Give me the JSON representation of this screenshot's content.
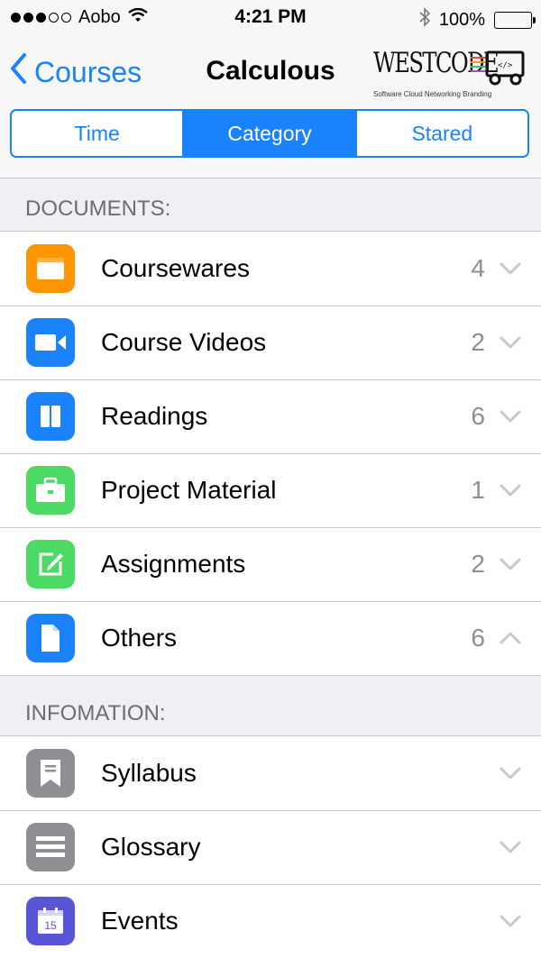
{
  "status_bar": {
    "carrier": "Aobo",
    "time": "4:21 PM",
    "battery": "100%"
  },
  "nav": {
    "back_label": "Courses",
    "title": "Calculous",
    "logo": {
      "word": "WESTCODE",
      "tagline": "Software  Cloud  Networking  Branding"
    }
  },
  "segments": [
    {
      "label": "Time",
      "active": false
    },
    {
      "label": "Category",
      "active": true
    },
    {
      "label": "Stared",
      "active": false
    }
  ],
  "documents": {
    "header": "DOCUMENTS:",
    "items": [
      {
        "label": "Coursewares",
        "count": "4",
        "icon": "folder-icon",
        "icon_color": "#ff9500",
        "chevron": "down"
      },
      {
        "label": "Course Videos",
        "count": "2",
        "icon": "video-camera-icon",
        "icon_color": "#1a82fb",
        "chevron": "down"
      },
      {
        "label": "Readings",
        "count": "6",
        "icon": "book-icon",
        "icon_color": "#1a82fb",
        "chevron": "down"
      },
      {
        "label": "Project Material",
        "count": "1",
        "icon": "briefcase-icon",
        "icon_color": "#4cd964",
        "chevron": "down"
      },
      {
        "label": "Assignments",
        "count": "2",
        "icon": "pencil-square-icon",
        "icon_color": "#4cd964",
        "chevron": "down"
      },
      {
        "label": "Others",
        "count": "6",
        "icon": "document-icon",
        "icon_color": "#1a82fb",
        "chevron": "up"
      }
    ]
  },
  "information": {
    "header": "INFOMATION:",
    "items": [
      {
        "label": "Syllabus",
        "icon": "bookmark-icon",
        "icon_color": "#8e8e93",
        "chevron": "down"
      },
      {
        "label": "Glossary",
        "icon": "list-icon",
        "icon_color": "#8e8e93",
        "chevron": "down"
      },
      {
        "label": "Events",
        "icon": "calendar-icon",
        "icon_color": "#5856d6",
        "calendar_day": "15",
        "chevron": "down"
      }
    ]
  },
  "colors": {
    "accent": "#1a82fb",
    "background": "#efeff4",
    "secondary_text": "#8e8e93"
  }
}
